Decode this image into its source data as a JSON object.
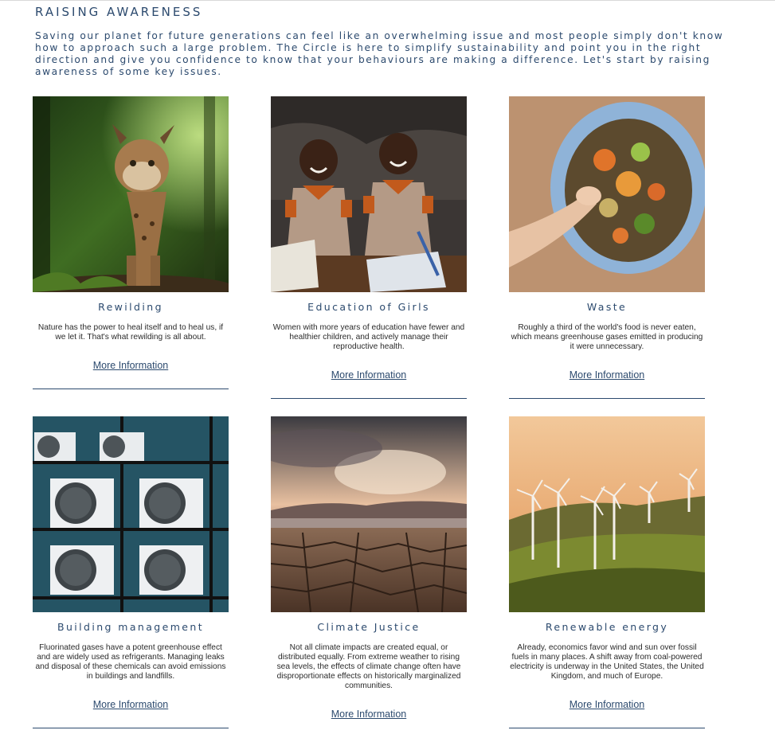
{
  "section": {
    "heading": "RAISING AWARENESS",
    "intro": "Saving our planet for future generations can feel like an overwhelming issue and most people simply don't know how to approach such a large problem. The Circle is here to simplify sustainability and point you in the right direction and give you confidence to know that your behaviours are making a difference. Let's start by raising awareness of some key issues."
  },
  "cards": [
    {
      "title": "Rewilding",
      "description": "Nature has the power to heal itself and to heal us, if we let it. That's what rewilding is all about.",
      "link": "More Information",
      "image": "lynx-in-forest-photo"
    },
    {
      "title": "Education of Girls",
      "description": "Women with more years of education have fewer and healthier children, and actively manage their reproductive health.",
      "link": "More Information",
      "image": "schoolgirls-writing-photo"
    },
    {
      "title": "Waste",
      "description": "Roughly a third of the world's food is never eaten, which means greenhouse gases emitted in producing it were unnecessary.",
      "link": "More Information",
      "image": "food-scraps-bin-photo"
    },
    {
      "title": "Building management",
      "description": "Fluorinated gases have a potent greenhouse effect and are widely used as refrigerants. Managing leaks and disposal of these chemicals can avoid emissions in buildings and landfills.",
      "link": "More Information",
      "image": "air-conditioner-units-photo"
    },
    {
      "title": "Climate Justice",
      "description": "Not all climate impacts are created equal, or distributed equally. From extreme weather to rising sea levels, the effects of climate change often have disproportionate effects on historically marginalized communities.",
      "link": "More Information",
      "image": "cracked-dry-earth-photo"
    },
    {
      "title": "Renewable energy",
      "description": "Already, economics favor wind and sun over fossil fuels in many places. A shift away from coal-powered electricity is underway in the United States, the United Kingdom, and much of Europe.",
      "link": "More Information",
      "image": "wind-turbines-field-photo"
    }
  ]
}
